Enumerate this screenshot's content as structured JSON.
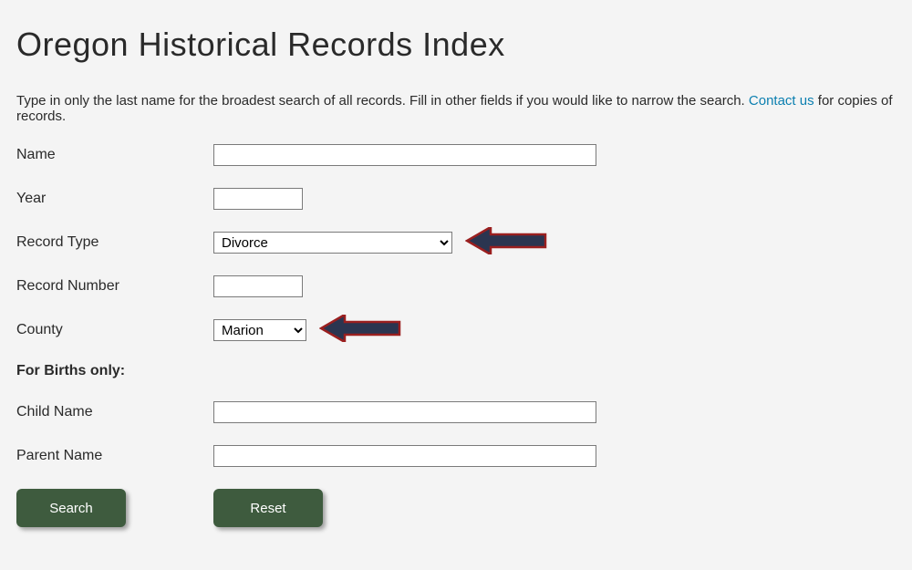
{
  "page": {
    "title": "Oregon Historical Records Index",
    "intro_before_link": "Type in only the last name for the broadest search of all records. Fill in other fields if you would like to narrow the search. ",
    "contact_link": "Contact us",
    "intro_after_link": " for copies of records."
  },
  "labels": {
    "name": "Name",
    "year": "Year",
    "record_type": "Record Type",
    "record_number": "Record Number",
    "county": "County",
    "births_section": "For Births only:",
    "child_name": "Child Name",
    "parent_name": "Parent Name"
  },
  "values": {
    "name": "",
    "year": "",
    "record_type": "Divorce",
    "record_number": "",
    "county": "Marion",
    "child_name": "",
    "parent_name": ""
  },
  "buttons": {
    "search": "Search",
    "reset": "Reset"
  }
}
